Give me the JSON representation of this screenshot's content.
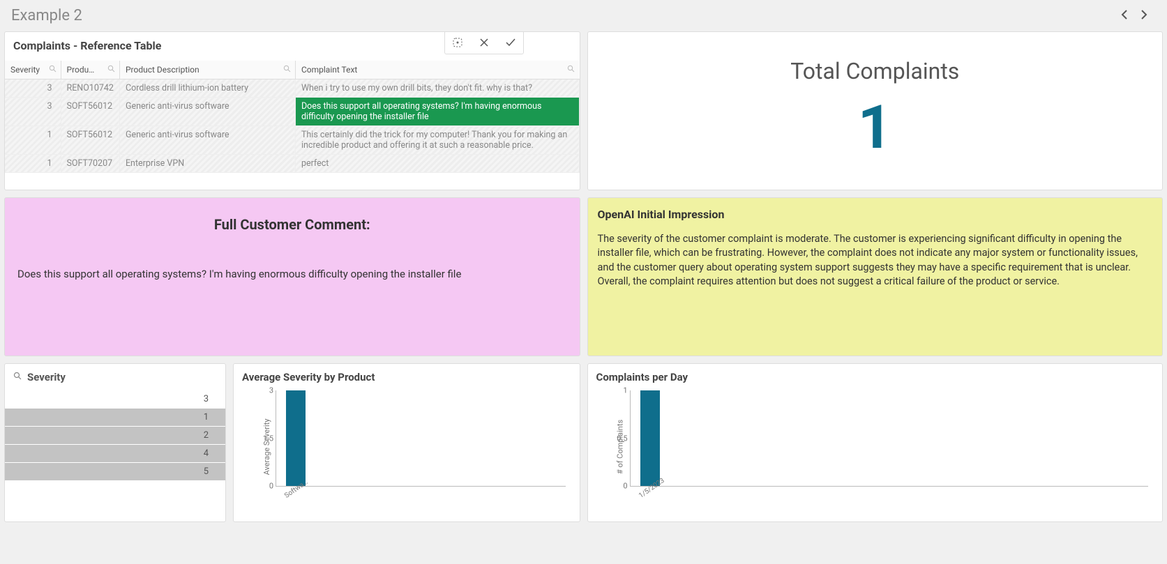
{
  "header": {
    "title": "Example 2"
  },
  "ref_table": {
    "title": "Complaints - Reference Table",
    "columns": {
      "severity": "Severity",
      "product": "Produ…",
      "description": "Product Description",
      "complaint": "Complaint Text"
    },
    "rows": [
      {
        "severity": "3",
        "product": "RENO10742",
        "description": "Cordless drill lithium-ion battery",
        "text": "When i try to use my own drill bits, they don't fit. why is that?",
        "hatched": true
      },
      {
        "severity": "3",
        "product": "SOFT56012",
        "description": "Generic anti-virus software",
        "text": "Does this support all operating systems? I'm having enormous difficulty opening the installer file",
        "selected": true
      },
      {
        "severity": "1",
        "product": "SOFT56012",
        "description": "Generic anti-virus software",
        "text": "This certainly did the trick for my computer! Thank you for making an incredible product and offering it at such a reasonable price.",
        "hatched": true
      },
      {
        "severity": "1",
        "product": "SOFT70207",
        "description": "Enterprise VPN",
        "text": "perfect",
        "hatched": true
      }
    ]
  },
  "kpi": {
    "title": "Total Complaints",
    "value": "1"
  },
  "comment": {
    "title": "Full Customer Comment:",
    "body": "Does this support all operating systems? I'm having enormous difficulty opening the installer file"
  },
  "impression": {
    "title": "OpenAI Initial Impression",
    "body": "The severity of the customer complaint is moderate. The customer is experiencing significant difficulty in opening the installer file, which can be frustrating. However, the complaint does not indicate any major system or functionality issues, and the customer query about operating system support suggests they may have a specific requirement that is unclear. Overall, the complaint requires attention but does not suggest a critical failure of the product or service."
  },
  "severity_filter": {
    "title": "Severity",
    "items": [
      {
        "label": "3",
        "dimmed": false
      },
      {
        "label": "1",
        "dimmed": true
      },
      {
        "label": "2",
        "dimmed": true
      },
      {
        "label": "4",
        "dimmed": true
      },
      {
        "label": "5",
        "dimmed": true
      }
    ]
  },
  "chart_avg": {
    "title": "Average Severity by Product",
    "ylabel": "Average Severity",
    "ticks": {
      "t0": "0",
      "t1": "1.5",
      "t2": "3"
    },
    "xlabel0": "Softwa…"
  },
  "chart_day": {
    "title": "Complaints per Day",
    "ylabel": "# of Complaints",
    "ticks": {
      "t0": "0",
      "t1": "0.5",
      "t2": "1"
    },
    "xlabel0": "1/5/2023"
  },
  "chart_data": [
    {
      "type": "bar",
      "title": "Average Severity by Product",
      "ylabel": "Average Severity",
      "ylim": [
        0,
        3
      ],
      "categories": [
        "Softwa…"
      ],
      "values": [
        3
      ]
    },
    {
      "type": "bar",
      "title": "Complaints per Day",
      "ylabel": "# of Complaints",
      "ylim": [
        0,
        1
      ],
      "categories": [
        "1/5/2023"
      ],
      "values": [
        1
      ]
    }
  ]
}
